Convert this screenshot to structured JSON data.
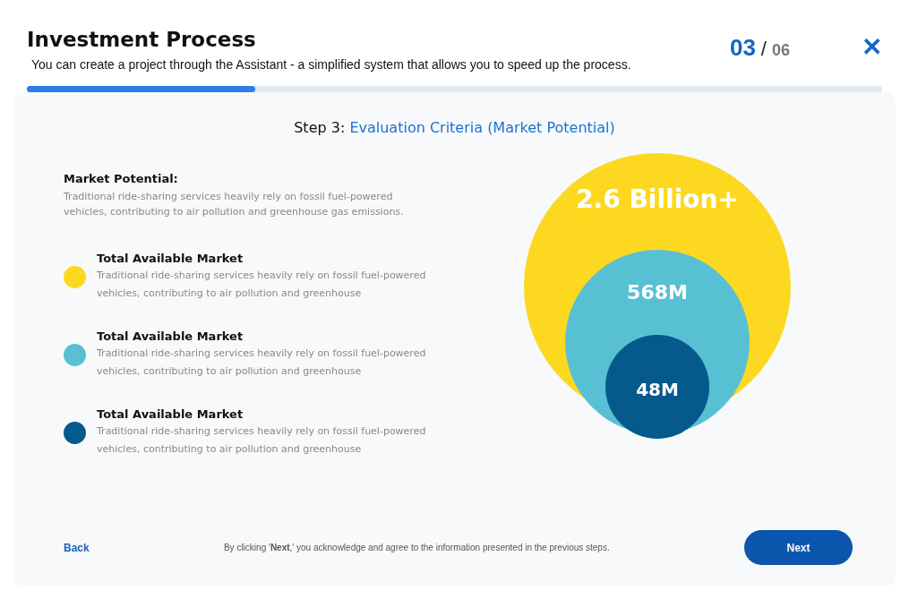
{
  "header": {
    "title": "Investment Process",
    "subtitle": "You can create a project through the Assistant - a simplified system that allows you to speed up the process.",
    "step_current": "03",
    "step_separator": "/",
    "step_total": "06",
    "close": "✕"
  },
  "progress": {
    "level": 0.267
  },
  "step": {
    "prefix": "Step 3:",
    "title": "Evaluation Criteria (Market Potential)"
  },
  "intro": {
    "title": "Market Potential:",
    "text": "Traditional ride-sharing services heavily rely on fossil fuel-powered vehicles, contributing to air pollution and greenhouse gas emissions."
  },
  "markets": [
    {
      "title": "Total Available Market",
      "text": "Traditional ride-sharing services heavily rely on fossil fuel-powered vehicles, contributing to air pollution and greenhouse",
      "color": "#fcd920",
      "figure": "2.6 Billion+"
    },
    {
      "title": "Total Available Market",
      "text": "Traditional ride-sharing services heavily rely on fossil fuel-powered vehicles, contributing to air pollution and greenhouse",
      "color": "#58c0d3",
      "figure": "568M"
    },
    {
      "title": "Total Available Market",
      "text": "Traditional ride-sharing services heavily rely on fossil fuel-powered vehicles, contributing to air pollution and greenhouse",
      "color": "#06598b",
      "figure": "48M"
    }
  ],
  "footer": {
    "back": "Back",
    "note": "By clicking '**Next**,' you acknowledge and agree to the information presented in the previous steps.",
    "next": "Next"
  }
}
